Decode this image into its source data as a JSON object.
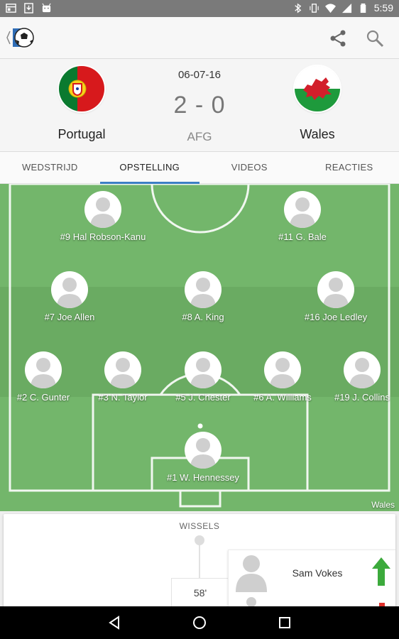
{
  "status_bar": {
    "time": "5:59",
    "icons": [
      "window-icon",
      "download-icon",
      "android-icon",
      "bluetooth-icon",
      "vibrate-icon",
      "wifi-icon",
      "cellular-icon",
      "battery-icon"
    ]
  },
  "app_bar": {
    "icons": [
      "app-logo",
      "share-icon",
      "search-icon"
    ]
  },
  "match": {
    "date": "06-07-16",
    "score": "2 - 0",
    "status": "AFG",
    "home_team": "Portugal",
    "away_team": "Wales"
  },
  "tabs": [
    {
      "label": "WEDSTRIJD"
    },
    {
      "label": "OPSTELLING"
    },
    {
      "label": "VIDEOS"
    },
    {
      "label": "REACTIES"
    }
  ],
  "lineup": {
    "team": "Wales",
    "players": [
      {
        "label": "#9 Hal Robson-Kanu"
      },
      {
        "label": "#11 G. Bale"
      },
      {
        "label": "#7 Joe Allen"
      },
      {
        "label": "#8 A. King"
      },
      {
        "label": "#16 Joe Ledley"
      },
      {
        "label": "#2 C. Gunter"
      },
      {
        "label": "#3 N. Taylor"
      },
      {
        "label": "#5 J. Chester"
      },
      {
        "label": "#6 A. Williams"
      },
      {
        "label": "#19 J. Collins"
      },
      {
        "label": "#1 W. Hennessey"
      }
    ]
  },
  "subs": {
    "title": "WISSELS",
    "minute": "58'",
    "player_in": "Sam Vokes"
  },
  "colors": {
    "pitch": "#73b66b",
    "tab_indicator": "#3c7fc4",
    "sub_in": "#3caa3c",
    "sub_out": "#e0302b"
  }
}
